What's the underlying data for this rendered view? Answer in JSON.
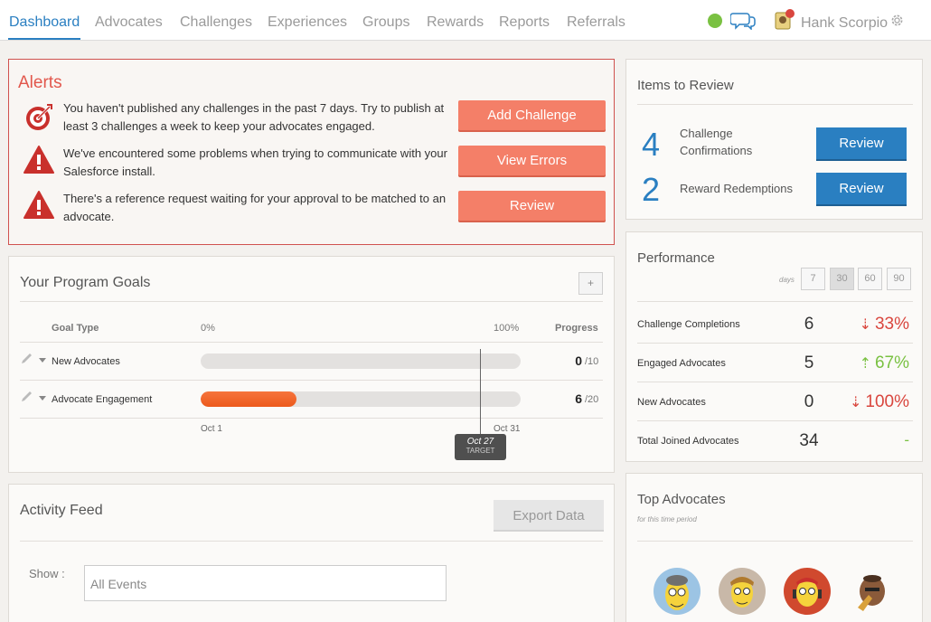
{
  "nav": {
    "tabs": [
      "Dashboard",
      "Advocates",
      "Challenges",
      "Experiences",
      "Groups",
      "Rewards",
      "Reports",
      "Referrals"
    ],
    "active_tab": "Dashboard",
    "user_name": "Hank Scorpio"
  },
  "alerts": {
    "title": "Alerts",
    "items": [
      {
        "icon": "target-icon",
        "text": "You haven't published any challenges in the past 7 days. Try to publish at least 3 challenges a week to keep your advocates engaged.",
        "button": "Add Challenge"
      },
      {
        "icon": "warning-icon",
        "text": "We've encountered some problems when trying to communicate with your Salesforce install.",
        "button": "View Errors"
      },
      {
        "icon": "warning-icon",
        "text": "There's a reference request waiting for your approval to be matched to an advocate.",
        "button": "Review"
      }
    ]
  },
  "goals": {
    "title": "Your Program Goals",
    "add_label": "+",
    "col_goal_type": "Goal Type",
    "col_zero": "0%",
    "col_hundred": "100%",
    "col_progress": "Progress",
    "rows": [
      {
        "name": "New Advocates",
        "value": "0",
        "max": "/10",
        "fraction": 0.0
      },
      {
        "name": "Advocate Engagement",
        "value": "6",
        "max": "/20",
        "fraction": 0.3
      }
    ],
    "start_label": "Oct 1",
    "end_label": "Oct 31",
    "target_date": "Oct 27",
    "target_label": "TARGET",
    "target_fraction": 0.87
  },
  "feed": {
    "title": "Activity Feed",
    "export_label": "Export Data",
    "show_label": "Show :",
    "filter_value": "All Events"
  },
  "review": {
    "title": "Items to Review",
    "items": [
      {
        "count": "4",
        "label": "Challenge Confirmations",
        "button": "Review"
      },
      {
        "count": "2",
        "label": "Reward Redemptions",
        "button": "Review"
      }
    ]
  },
  "performance": {
    "title": "Performance",
    "days_label": "days",
    "day_options": [
      "7",
      "30",
      "60",
      "90"
    ],
    "active_days": "30",
    "rows": [
      {
        "label": "Challenge Completions",
        "value": "6",
        "change": "33%",
        "direction": "down"
      },
      {
        "label": "Engaged Advocates",
        "value": "5",
        "change": "67%",
        "direction": "up"
      },
      {
        "label": "New Advocates",
        "value": "0",
        "change": "100%",
        "direction": "down"
      },
      {
        "label": "Total Joined Advocates",
        "value": "34",
        "change": "-",
        "direction": "none"
      }
    ]
  },
  "top_advocates": {
    "title": "Top Advocates",
    "note": "for this time period",
    "avatars": [
      "avatar-1",
      "avatar-2",
      "avatar-3",
      "avatar-4"
    ]
  },
  "colors": {
    "accent": "#2a7fc1",
    "alert_red": "#e2574c",
    "salmon": "#f47f68",
    "up_green": "#7ac142",
    "down_red": "#d9463e",
    "bar_orange": "#ec5a1c"
  }
}
